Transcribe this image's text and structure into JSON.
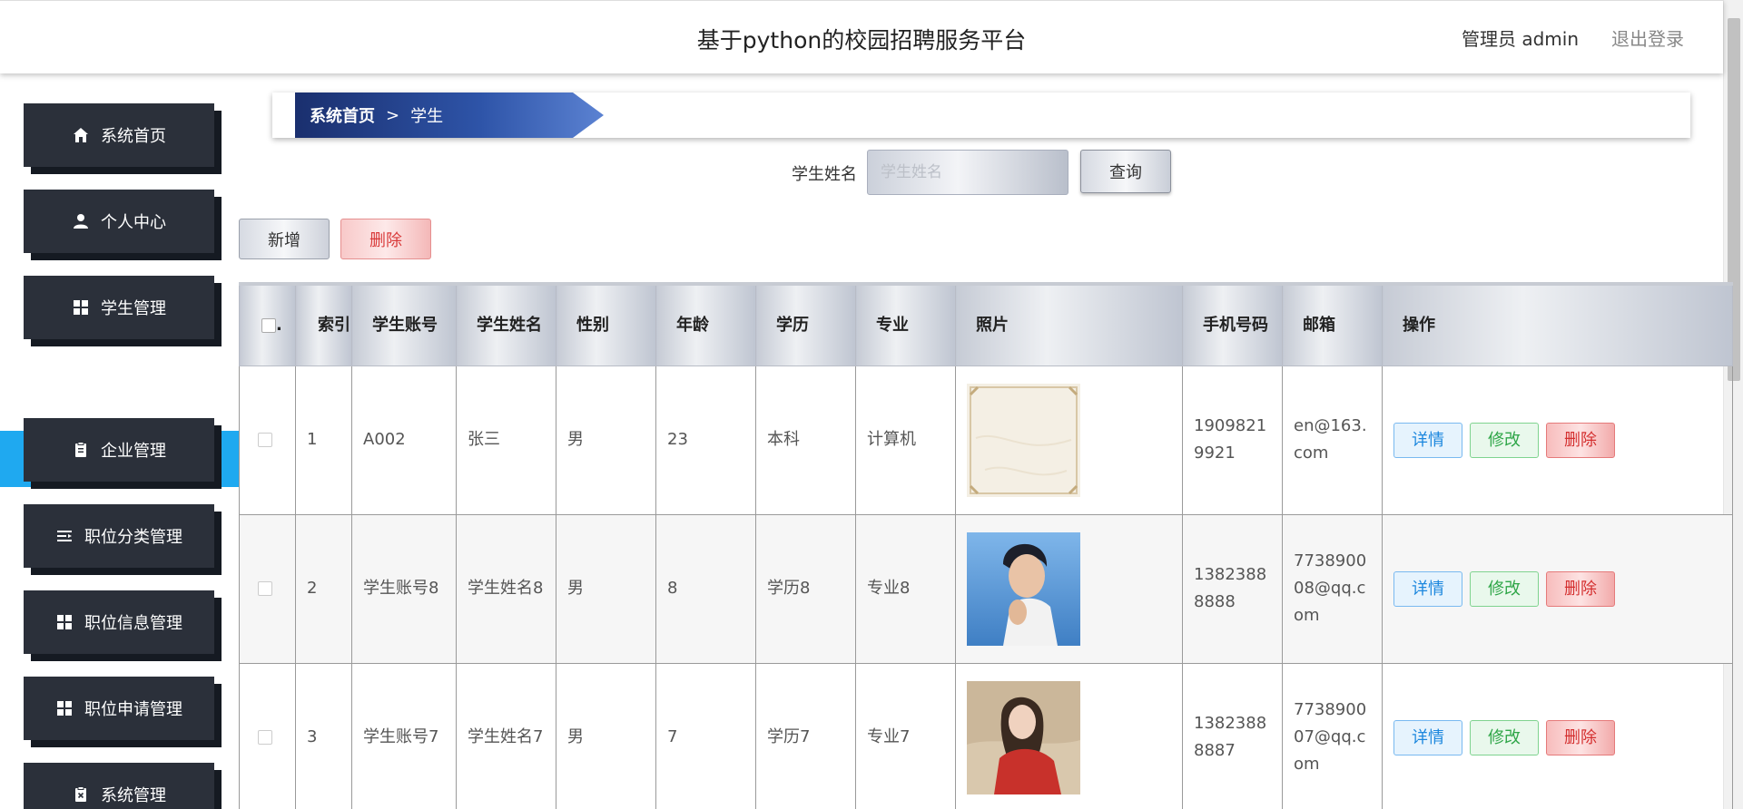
{
  "header": {
    "title": "基于python的校园招聘服务平台",
    "admin_label": "管理员 admin",
    "logout_label": "退出登录"
  },
  "sidebar": {
    "items": [
      {
        "label": "系统首页",
        "icon": "home-icon"
      },
      {
        "label": "个人中心",
        "icon": "user-icon"
      },
      {
        "label": "学生管理",
        "icon": "grid-icon"
      },
      {
        "label": "企业管理",
        "icon": "clipboard-icon"
      },
      {
        "label": "职位分类管理",
        "icon": "list-icon"
      },
      {
        "label": "职位信息管理",
        "icon": "grid-icon"
      },
      {
        "label": "职位申请管理",
        "icon": "grid-icon"
      },
      {
        "label": "系统管理",
        "icon": "clipboard-x-icon"
      }
    ],
    "active_sub": "学生"
  },
  "breadcrumb": {
    "home": "系统首页",
    "separator": ">",
    "current": "学生"
  },
  "search": {
    "label": "学生姓名",
    "placeholder": "学生姓名",
    "button": "查询"
  },
  "actions": {
    "add": "新增",
    "delete": "删除"
  },
  "table": {
    "columns": [
      "索引",
      "学生账号",
      "学生姓名",
      "性别",
      "年龄",
      "学历",
      "专业",
      "照片",
      "手机号码",
      "邮箱",
      "操作"
    ],
    "row_actions": {
      "detail": "详情",
      "edit": "修改",
      "delete": "删除"
    },
    "rows": [
      {
        "index": "1",
        "account": "A002",
        "name": "张三",
        "gender": "男",
        "age": "23",
        "education": "本科",
        "major": "计算机",
        "photo": "beige-paper-texture",
        "phone": "19098219921",
        "email": "en@163.com"
      },
      {
        "index": "2",
        "account": "学生账号8",
        "name": "学生姓名8",
        "gender": "男",
        "age": "8",
        "education": "学历8",
        "major": "专业8",
        "photo": "young-man-portrait",
        "phone": "13823888888",
        "email": "773890008@qq.com"
      },
      {
        "index": "3",
        "account": "学生账号7",
        "name": "学生姓名7",
        "gender": "男",
        "age": "7",
        "education": "学历7",
        "major": "专业7",
        "photo": "woman-red-scarf-portrait",
        "phone": "13823888887",
        "email": "773890007@qq.com"
      }
    ]
  },
  "colors": {
    "sidebar_button": "#2b303a",
    "sidebar_active": "#1fa9f0",
    "breadcrumb_start": "#1a2f6e",
    "breadcrumb_end": "#5b82d2"
  }
}
